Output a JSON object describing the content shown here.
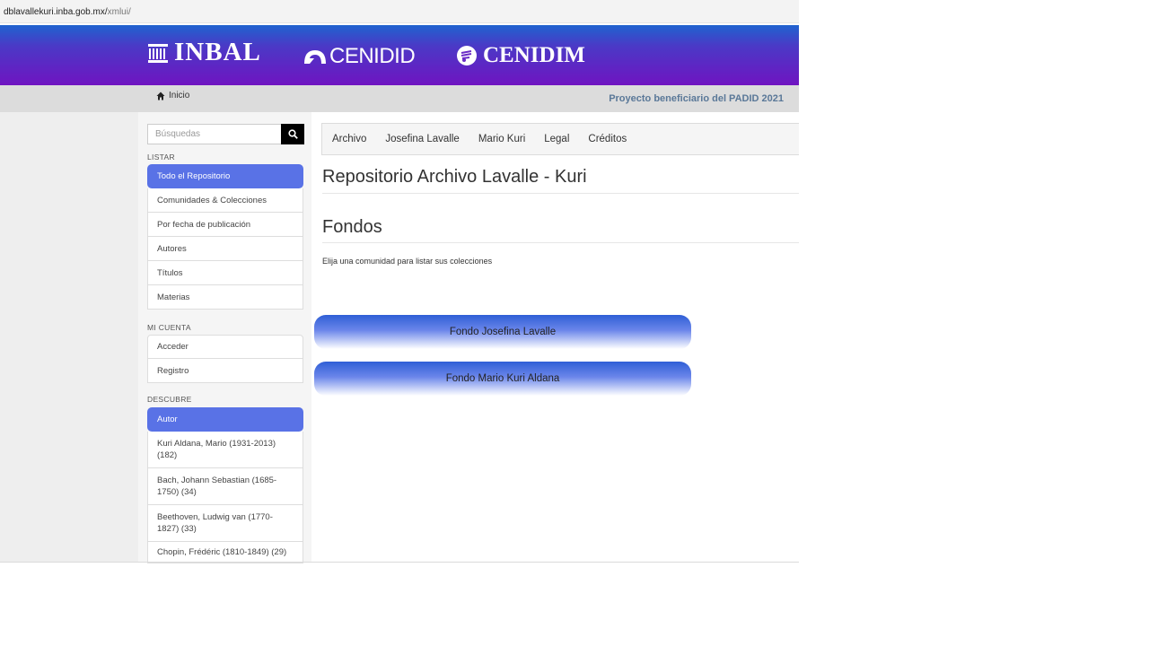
{
  "browser": {
    "url_host": "dblavallekuri.inba.gob.mx/",
    "url_path": "xmlui/"
  },
  "header": {
    "logos": [
      {
        "name": "inbal",
        "text": "INBAL",
        "icon": "inbal-building-icon"
      },
      {
        "name": "cenidid",
        "text": "CENIDID",
        "icon": "cenidid-mark-icon"
      },
      {
        "name": "cenidim",
        "text": "CENIDIM",
        "icon": "cenidim-mark-icon"
      }
    ]
  },
  "breadcrumb": {
    "icon": "home-icon",
    "label": "Inicio"
  },
  "project_note": "Proyecto beneficiario del PADID 2021",
  "search": {
    "placeholder": "Búsquedas",
    "icon": "search-icon"
  },
  "sidebar": {
    "listar": {
      "heading": "LISTAR",
      "items": [
        "Todo el Repositorio",
        "Comunidades & Colecciones",
        "Por fecha de publicación",
        "Autores",
        "Títulos",
        "Materias"
      ]
    },
    "cuenta": {
      "heading": "MI CUENTA",
      "items": [
        "Acceder",
        "Registro"
      ]
    },
    "descubre": {
      "heading": "DESCUBRE",
      "items": [
        "Autor",
        "Kuri Aldana, Mario (1931-2013) (182)",
        "Bach, Johann Sebastian (1685-1750) (34)",
        "Beethoven, Ludwig van (1770-1827) (33)",
        "Chopin, Frédéric (1810-1849) (29)"
      ]
    }
  },
  "topnav": [
    "Archivo",
    "Josefina Lavalle",
    "Mario Kuri",
    "Legal",
    "Créditos"
  ],
  "main": {
    "title": "Repositorio Archivo Lavalle - Kuri",
    "section_title": "Fondos",
    "description": "Elija una comunidad para listar sus colecciones",
    "fondos": [
      "Fondo Josefina Lavalle",
      "Fondo Mario Kuri Aldana"
    ]
  },
  "colors": {
    "banner_top": "#1f63cf",
    "banner_bottom": "#6f14c1",
    "active_item": "#5972e6",
    "padid_text": "#5a7898"
  }
}
